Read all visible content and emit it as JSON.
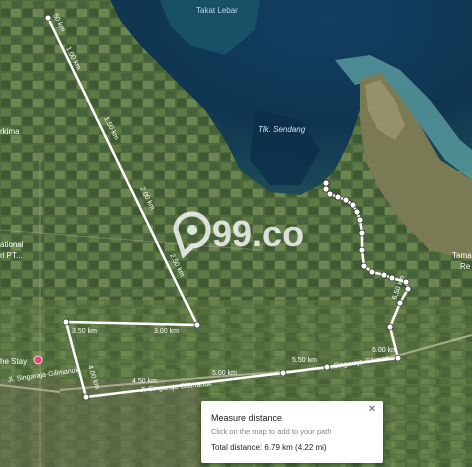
{
  "places": {
    "takat_lebar": "Takat Lebar",
    "tlk_sendang": "Tlk. Sendang",
    "rkima": "rkima",
    "national": "ational",
    "ht_pt": "ri PT...",
    "tama": "Tama",
    "re": "Re",
    "the_stay": "he Stay",
    "jl_singaraja_left": "Jl. Singaraja-Gilimanuk",
    "jl_singaraja_mid": "Jl. Singaraja-Gilimanuk",
    "jl_singaraja_right": "Singaraja-Giliman"
  },
  "watermark": "99.co",
  "distance_labels": {
    "d100": "1.00 km",
    "d150": "1.50 km",
    "d200": "2.00 km",
    "d250": "2.50 km",
    "d300": "3.00 km",
    "d350": "3.50 km",
    "d400": "4.00 km",
    "d450": "4.50 km",
    "d500": "5.00 km",
    "d550": "5.50 km",
    "d600": "6.00 km",
    "d650": "6.50 km",
    "d50": "50 km"
  },
  "measure_panel": {
    "title": "Measure distance",
    "hint": "Click on the map to add to your path",
    "total": "Total distance: 6.79 km (4.22 mi)",
    "close_icon": "close-icon"
  },
  "colors": {
    "sea": "#0f3a5a",
    "land": "#4f6a3a",
    "path": "#ffffff",
    "marker": "#e8457a"
  }
}
